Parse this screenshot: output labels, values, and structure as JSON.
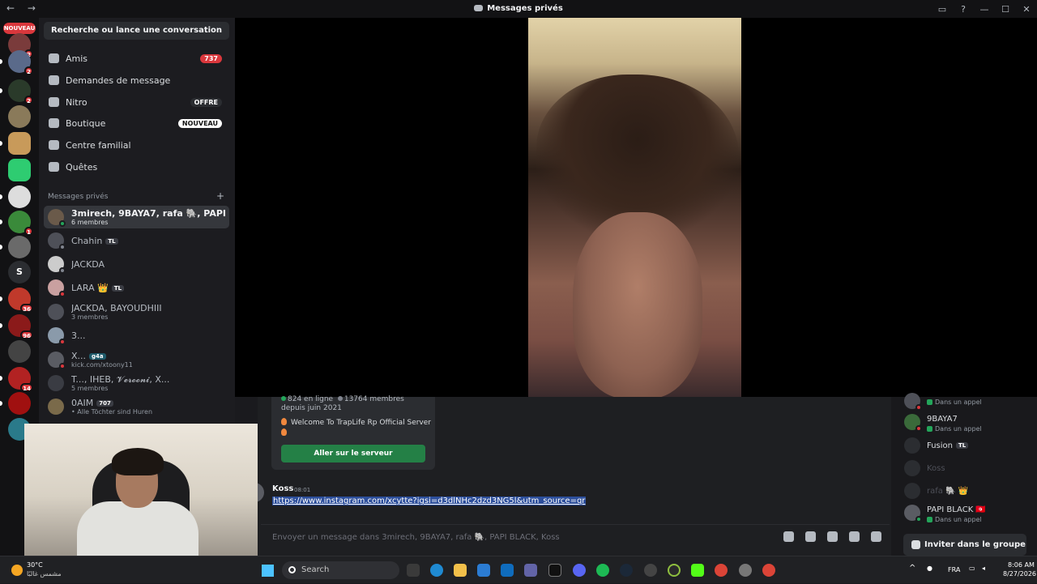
{
  "window": {
    "title": "Messages privés",
    "nav": "← →"
  },
  "rail": {
    "new_label": "NOUVEAU",
    "server_letter": "S",
    "badges": [
      "2",
      "2",
      "2",
      "1",
      "36",
      "96",
      "14"
    ]
  },
  "sidebar": {
    "search_label": "Recherche ou lance une conversation",
    "nav": [
      {
        "label": "Amis",
        "badge": "737"
      },
      {
        "label": "Demandes de message"
      },
      {
        "label": "Nitro",
        "badge": "OFFRE"
      },
      {
        "label": "Boutique",
        "badge": "NOUVEAU"
      },
      {
        "label": "Centre familial"
      },
      {
        "label": "Quêtes"
      }
    ],
    "section_label": "Messages privés",
    "section_add": "+",
    "dms": [
      {
        "name": "3mirech, 9BAYA7, rafa 🐘, PAPI BLACK,...",
        "sub": "6 membres"
      },
      {
        "name": "Chahin",
        "tag": "TL"
      },
      {
        "name": "JACKDA"
      },
      {
        "name": "LARA 👑",
        "tag": "TL"
      },
      {
        "name": "JACKDA, BAYOUDHIII",
        "sub": "3 membres"
      },
      {
        "name": "3..."
      },
      {
        "name": "X...",
        "tag": "g4a",
        "sub": "kick.com/xtoony11"
      },
      {
        "name": "T..., IHEB, 𝓥𝓮𝓻𝓸𝓸𝓷𝓲, X...",
        "sub": "5 membres"
      },
      {
        "name": "0AIM",
        "tag": "707",
        "sub": "• Alle Töchter sind Huren"
      }
    ]
  },
  "chat": {
    "embed": {
      "online": "824 en ligne",
      "members": "13764 membres",
      "since": "depuis juin 2021",
      "description": "Welcome To TrapLife Rp Official Server",
      "button": "Aller sur le serveur"
    },
    "message": {
      "author": "Koss",
      "time": "08:01",
      "link": "https://www.instagram.com/xcytte?igsi=d3dlNHc2dzd3NG5l&utm_source=qr"
    },
    "input_placeholder": "Envoyer un message dans 3mirech, 9BAYA7, rafa 🐘, PAPI BLACK, Koss"
  },
  "members": {
    "items": [
      {
        "name": "",
        "sub": "Dans un appel"
      },
      {
        "name": "9BAYA7",
        "sub": "Dans un appel"
      },
      {
        "name": "Fusion",
        "tag": "TL"
      },
      {
        "name": "Koss"
      },
      {
        "name": "rafa 🐘 👑"
      },
      {
        "name": "PAPI BLACK 🇹🇳",
        "sub": "Dans un appel"
      }
    ],
    "invite_label": "Inviter dans le groupe p..."
  },
  "taskbar": {
    "temp": "30°C",
    "weather_desc": "مشمس غالبًا",
    "search_label": "Search",
    "lang": "FRA",
    "time": "8:06 AM",
    "date": "8/27/2026",
    "colors": {
      "accent": "#5865f2",
      "green": "#23a55a",
      "red": "#da373c"
    }
  }
}
